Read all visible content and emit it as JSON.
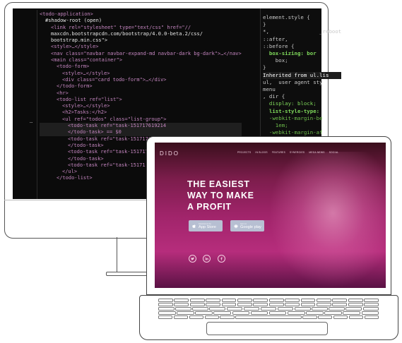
{
  "code_lines": [
    [
      "<todo-application>"
    ],
    [
      "#shadow-root (open)"
    ],
    [
      "<link rel=\"stylesheet\" type=\"text/css\" href=\"//"
    ],
    [
      "maxcdn.bootstrapcdn.com/bootstrap/4.0.0-beta.2/css/"
    ],
    [
      "bootstrap.min.css\">"
    ],
    [
      "<style>…</style>"
    ],
    [
      "<nav class=\"navbar navbar-expand-md navbar-dark bg-dark\">…</nav>"
    ],
    [
      "<main class=\"container\">"
    ],
    [
      "<todo-form>"
    ],
    [
      "<style>…</style>"
    ],
    [
      "<div class=\"card todo-form\">…</div>"
    ],
    [
      "</todo-form>"
    ],
    [
      "<hr>"
    ],
    [
      "<todo-list ref=\"list\">"
    ],
    [
      "<style>…</style>"
    ],
    [
      "<h2>Tasks:</h2>"
    ],
    [
      "<ul ref=\"todos\" class=\"list-group\">"
    ],
    [
      "<todo-task ref=\"task-151717619214"
    ],
    [
      "</todo-task> == $0"
    ],
    [
      "<todo-task ref=\"task-1517176"
    ],
    [
      "</todo-task>"
    ],
    [
      "<todo-task ref=\"task-151717"
    ],
    [
      "</todo-task>"
    ],
    [
      "<todo-task ref=\"task-15171"
    ],
    [
      "</ul>"
    ],
    [
      "</todo-list>"
    ]
  ],
  "gutter_marker": "…",
  "style_lines": [
    "element.style {",
    "}",
    "*,                _reboot",
    "::after,",
    "::before {",
    "  box-sizing: bor",
    "    box;",
    "}",
    "Inherited from ul.lis",
    "ul,  user agent sty",
    "menu",
    ", dir {",
    "  display: block;",
    "  list-style-type:",
    "  -webkit-margin-be",
    "    1em;",
    "  -webkit-margin-af"
  ],
  "site": {
    "logo": "DIDO",
    "nav": [
      "Projects",
      "In Blogs",
      "Features",
      "Synergies",
      "Mega news",
      "Social"
    ],
    "hero": "THE EASIEST\nWAY TO MAKE\nA PROFIT",
    "app_store": {
      "small": "Download on the",
      "big": "App Store"
    },
    "google_play": {
      "small": "Get it on",
      "big": "Google play"
    },
    "social_icons": [
      "twitter-icon",
      "linkedin-icon",
      "facebook-icon"
    ]
  },
  "colors": {
    "code_bg": "#0b0b0b",
    "tag": "#c586c0",
    "site_gradient_top": "#3a0f1c",
    "site_gradient_mid": "#a0246a",
    "button": "#b7bfd2"
  }
}
